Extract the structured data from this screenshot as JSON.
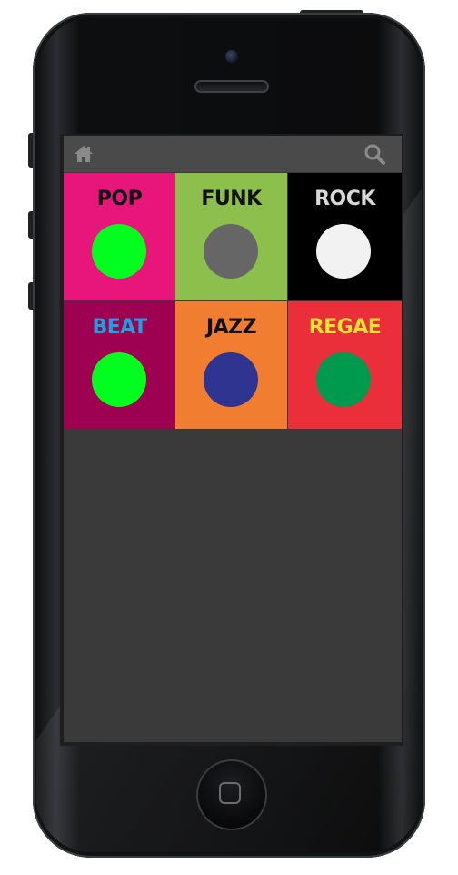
{
  "device": {
    "frame_color": "#0c0d0f",
    "screen_bg": "#3a3a3a",
    "header_bg": "#4a4a4a",
    "header_icon_color": "#8a8a8a"
  },
  "header": {
    "left_icon": "home-icon",
    "right_icon": "search-icon"
  },
  "genres": [
    {
      "label": "POP",
      "bg": "#e8157a",
      "label_color": "#111111",
      "dot": "#00ff1e"
    },
    {
      "label": "FUNK",
      "bg": "#8cbf4c",
      "label_color": "#111111",
      "dot": "#666666"
    },
    {
      "label": "ROCK",
      "bg": "#000000",
      "label_color": "#d8d8d8",
      "dot": "#f2f2f2"
    },
    {
      "label": "BEAT",
      "bg": "#9e0052",
      "label_color": "#1fa0e0",
      "dot": "#00ff1e"
    },
    {
      "label": "JAZZ",
      "bg": "#f07d30",
      "label_color": "#111111",
      "dot": "#2e3490"
    },
    {
      "label": "REGAE",
      "bg": "#ea2f3a",
      "label_color": "#ffe232",
      "dot": "#009a4e"
    }
  ]
}
